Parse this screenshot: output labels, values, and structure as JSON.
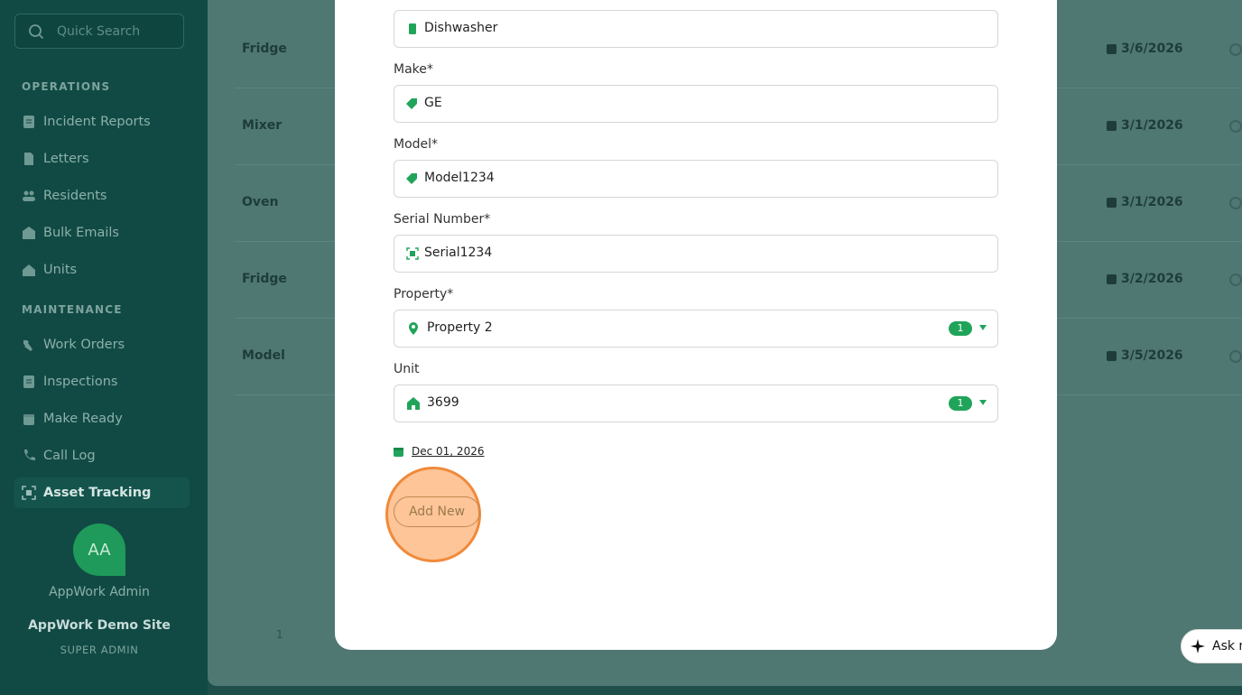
{
  "sidebar": {
    "search_placeholder": "Quick Search",
    "sections": {
      "operations": "OPERATIONS",
      "maintenance": "MAINTENANCE"
    },
    "items": [
      {
        "label": "Incident Reports",
        "icon": "document-icon"
      },
      {
        "label": "Letters",
        "icon": "letter-icon"
      },
      {
        "label": "Residents",
        "icon": "people-icon"
      },
      {
        "label": "Bulk Emails",
        "icon": "mail-icon"
      },
      {
        "label": "Units",
        "icon": "house-icon"
      },
      {
        "label": "Work Orders",
        "icon": "wrench-icon"
      },
      {
        "label": "Inspections",
        "icon": "clipboard-icon"
      },
      {
        "label": "Make Ready",
        "icon": "calendar-icon"
      },
      {
        "label": "Call Log",
        "icon": "phone-icon"
      },
      {
        "label": "Asset Tracking",
        "icon": "scan-icon"
      }
    ],
    "active_item": "Asset Tracking",
    "user": {
      "initials": "AA",
      "name": "AppWork Admin",
      "site": "AppWork Demo Site",
      "role": "SUPER ADMIN"
    }
  },
  "table": {
    "rows": [
      {
        "name": "Fridge",
        "date": "3/6/2026"
      },
      {
        "name": "Mixer",
        "date": "3/1/2026"
      },
      {
        "name": "Oven",
        "date": "3/1/2026"
      },
      {
        "name": "Fridge",
        "date": "3/2/2026"
      },
      {
        "name": "Model",
        "date": "3/5/2026"
      }
    ],
    "page": "1"
  },
  "form": {
    "type": {
      "value": "Dishwasher"
    },
    "make": {
      "label": "Make*",
      "value": "GE"
    },
    "model": {
      "label": "Model*",
      "value": "Model1234"
    },
    "serial": {
      "label": "Serial Number*",
      "value": "Serial1234"
    },
    "property": {
      "label": "Property*",
      "value": "Property 2",
      "count": "1"
    },
    "unit": {
      "label": "Unit",
      "value": "3699",
      "count": "1"
    },
    "date": "Dec 01, 2026",
    "submit_label": "Add New"
  },
  "assistant": {
    "label": "Ask m"
  },
  "colors": {
    "accent": "#20a45a",
    "sidebar": "#114a44",
    "highlight": "#f08a3a"
  }
}
